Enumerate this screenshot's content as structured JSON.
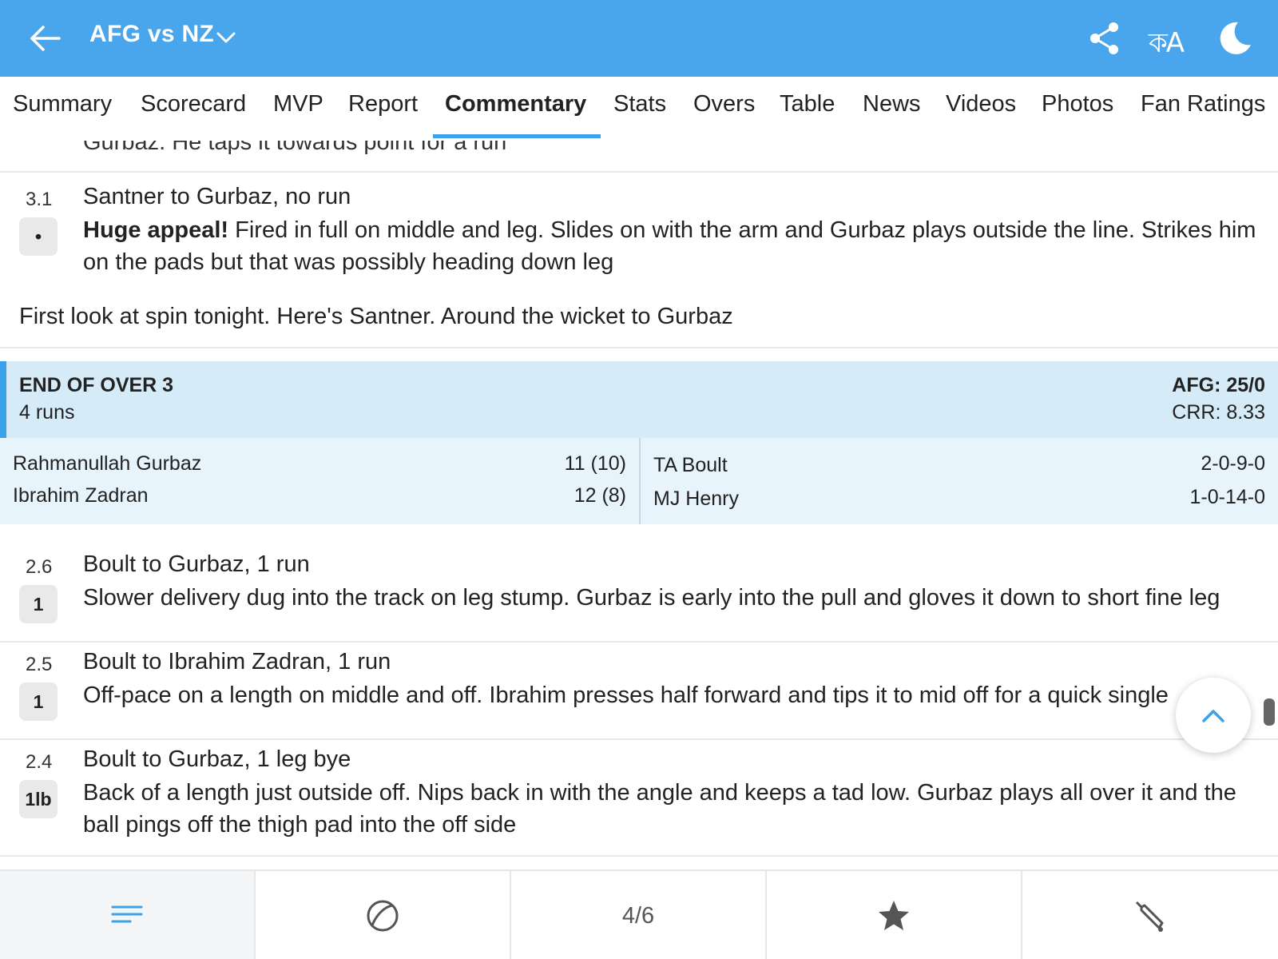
{
  "header": {
    "title": "AFG vs NZ",
    "lang_label": "কA"
  },
  "tabs": [
    "Summary",
    "Scorecard",
    "MVP",
    "Report",
    "Commentary",
    "Stats",
    "Overs",
    "Table",
    "News",
    "Videos",
    "Photos",
    "Fan Ratings"
  ],
  "active_tab": "Commentary",
  "commentary": {
    "partial_text": "Gurbaz. He taps it towards point for a run",
    "ball_31": {
      "over": "3.1",
      "badge": "•",
      "head": "Santner to Gurbaz, no run",
      "bold": "Huge appeal!",
      "desc": " Fired in full on middle and leg. Slides on with the arm and Gurbaz plays outside the line. Strikes him on the pads but that was possibly heading down leg"
    },
    "note": "First look at spin tonight. Here's Santner. Around the wicket to Gurbaz",
    "end_of_over": {
      "title": "END OF OVER 3",
      "runs": "4 runs",
      "score": "AFG: 25/0",
      "crr": "CRR: 8.33"
    },
    "batters": [
      {
        "name": "Rahmanullah Gurbaz",
        "fig": "11 (10)"
      },
      {
        "name": "Ibrahim Zadran",
        "fig": "12 (8)"
      }
    ],
    "bowlers": [
      {
        "name": "TA Boult",
        "fig": "2-0-9-0"
      },
      {
        "name": "MJ Henry",
        "fig": "1-0-14-0"
      }
    ],
    "ball_26": {
      "over": "2.6",
      "badge": "1",
      "head": "Boult to Gurbaz, 1 run",
      "desc": "Slower delivery dug into the track on leg stump. Gurbaz is early into the pull and gloves it down to short fine leg"
    },
    "ball_25": {
      "over": "2.5",
      "badge": "1",
      "head": "Boult to Ibrahim Zadran, 1 run",
      "desc": "Off-pace on a length on middle and off. Ibrahim presses half forward and tips it to mid off for a quick single"
    },
    "ball_24": {
      "over": "2.4",
      "badge": "1lb",
      "head": "Boult to Gurbaz, 1 leg bye",
      "desc": "Back of a length just outside off. Nips back in with the angle and keeps a tad low. Gurbaz plays all over it and the ball pings off the thigh pad into the off side"
    }
  },
  "bottom_nav": {
    "page_indicator": "4/6",
    "icons": [
      "list-icon",
      "ball-icon",
      "page-indicator",
      "star-icon",
      "bat-icon"
    ]
  },
  "colors": {
    "header_bg": "#4aa6ec",
    "accent": "#3ba1ea",
    "over_summary_bg": "#d5ebf8",
    "players_bg": "#e7f4fb"
  }
}
